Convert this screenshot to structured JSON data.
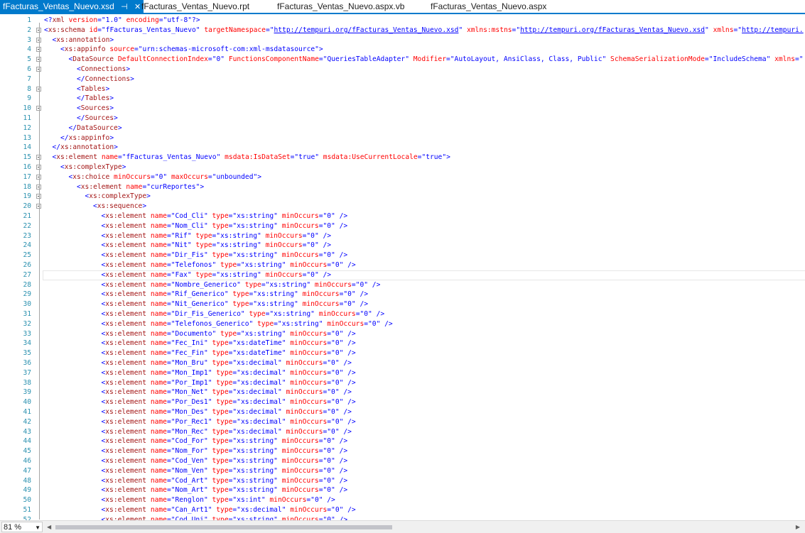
{
  "tabs": [
    {
      "label": "fFacturas_Ventas_Nuevo.xsd",
      "active": true
    },
    {
      "label": "fFacturas_Ventas_Nuevo.rpt",
      "active": false
    },
    {
      "label": "fFacturas_Ventas_Nuevo.aspx.vb",
      "active": false
    },
    {
      "label": "fFacturas_Ventas_Nuevo.aspx",
      "active": false
    }
  ],
  "icons": {
    "pin": "pin-icon",
    "close": "close-icon",
    "zoom_dropdown": "chevron-down-icon",
    "scroll_left": "arrow-left-icon",
    "scroll_right": "arrow-right-icon"
  },
  "colors": {
    "accent": "#007acc",
    "tag": "#a31515",
    "attr": "#ff0000",
    "value": "#0000ff",
    "linenum": "#2b91af"
  },
  "status": {
    "zoom": "81 %"
  },
  "lines": [
    {
      "n": "1",
      "fold": false,
      "html": "<span class='d'>&lt;?</span><span class='t'>xml</span> <span class='a'>version</span><span class='d'>=</span><span class='d'>\"</span><span class='v'>1.0</span><span class='d'>\"</span> <span class='a'>encoding</span><span class='d'>=</span><span class='d'>\"</span><span class='v'>utf-8</span><span class='d'>\"?&gt;</span>"
    },
    {
      "n": "2",
      "fold": true,
      "html": "<span class='d'>&lt;</span><span class='t'>xs:schema</span> <span class='a'>id</span><span class='d'>=</span><span class='d'>\"</span><span class='v'>fFacturas_Ventas_Nuevo</span><span class='d'>\"</span> <span class='a'>targetNamespace</span><span class='d'>=</span><span class='d'>\"</span><span class='u'>http://tempuri.org/fFacturas_Ventas_Nuevo.xsd</span><span class='d'>\"</span> <span class='a'>xmlns:mstns</span><span class='d'>=</span><span class='d'>\"</span><span class='u'>http://tempuri.org/fFacturas_Ventas_Nuevo.xsd</span><span class='d'>\"</span> <span class='a'>xmlns</span><span class='d'>=</span><span class='d'>\"</span><span class='u'>http://tempuri.</span>"
    },
    {
      "n": "3",
      "fold": true,
      "indent": 1,
      "html": "<span class='d'>&lt;</span><span class='t'>xs:annotation</span><span class='d'>&gt;</span>"
    },
    {
      "n": "4",
      "fold": true,
      "indent": 2,
      "html": "<span class='d'>&lt;</span><span class='t'>xs:appinfo</span> <span class='a'>source</span><span class='d'>=</span><span class='d'>\"</span><span class='v'>urn:schemas-microsoft-com:xml-msdatasource</span><span class='d'>\"&gt;</span>"
    },
    {
      "n": "5",
      "fold": true,
      "indent": 3,
      "html": "<span class='d'>&lt;</span><span class='t'>DataSource</span> <span class='a'>DefaultConnectionIndex</span><span class='d'>=</span><span class='d'>\"</span><span class='v'>0</span><span class='d'>\"</span> <span class='a'>FunctionsComponentName</span><span class='d'>=</span><span class='d'>\"</span><span class='v'>QueriesTableAdapter</span><span class='d'>\"</span> <span class='a'>Modifier</span><span class='d'>=</span><span class='d'>\"</span><span class='v'>AutoLayout, AnsiClass, Class, Public</span><span class='d'>\"</span> <span class='a'>SchemaSerializationMode</span><span class='d'>=</span><span class='d'>\"</span><span class='v'>IncludeSchema</span><span class='d'>\"</span> <span class='a'>xmlns</span><span class='d'>=</span><span class='d'>\"</span>"
    },
    {
      "n": "6",
      "fold": true,
      "indent": 4,
      "html": "<span class='d'>&lt;</span><span class='t'>Connections</span><span class='d'>&gt;</span>"
    },
    {
      "n": "7",
      "fold": false,
      "indent": 4,
      "html": "<span class='d'>&lt;/</span><span class='t'>Connections</span><span class='d'>&gt;</span>"
    },
    {
      "n": "8",
      "fold": true,
      "indent": 4,
      "html": "<span class='d'>&lt;</span><span class='t'>Tables</span><span class='d'>&gt;</span>"
    },
    {
      "n": "9",
      "fold": false,
      "indent": 4,
      "html": "<span class='d'>&lt;/</span><span class='t'>Tables</span><span class='d'>&gt;</span>"
    },
    {
      "n": "10",
      "fold": true,
      "indent": 4,
      "html": "<span class='d'>&lt;</span><span class='t'>Sources</span><span class='d'>&gt;</span>"
    },
    {
      "n": "11",
      "fold": false,
      "indent": 4,
      "html": "<span class='d'>&lt;/</span><span class='t'>Sources</span><span class='d'>&gt;</span>"
    },
    {
      "n": "12",
      "fold": false,
      "indent": 3,
      "html": "<span class='d'>&lt;/</span><span class='t'>DataSource</span><span class='d'>&gt;</span>"
    },
    {
      "n": "13",
      "fold": false,
      "indent": 2,
      "html": "<span class='d'>&lt;/</span><span class='t'>xs:appinfo</span><span class='d'>&gt;</span>"
    },
    {
      "n": "14",
      "fold": false,
      "indent": 1,
      "html": "<span class='d'>&lt;/</span><span class='t'>xs:annotation</span><span class='d'>&gt;</span>"
    },
    {
      "n": "15",
      "fold": true,
      "indent": 1,
      "html": "<span class='d'>&lt;</span><span class='t'>xs:element</span> <span class='a'>name</span><span class='d'>=</span><span class='d'>\"</span><span class='v'>fFacturas_Ventas_Nuevo</span><span class='d'>\"</span> <span class='a'>msdata:IsDataSet</span><span class='d'>=</span><span class='d'>\"</span><span class='v'>true</span><span class='d'>\"</span> <span class='a'>msdata:UseCurrentLocale</span><span class='d'>=</span><span class='d'>\"</span><span class='v'>true</span><span class='d'>\"&gt;</span>"
    },
    {
      "n": "16",
      "fold": true,
      "indent": 2,
      "html": "<span class='d'>&lt;</span><span class='t'>xs:complexType</span><span class='d'>&gt;</span>"
    },
    {
      "n": "17",
      "fold": true,
      "indent": 3,
      "html": "<span class='d'>&lt;</span><span class='t'>xs:choice</span> <span class='a'>minOccurs</span><span class='d'>=</span><span class='d'>\"</span><span class='v'>0</span><span class='d'>\"</span> <span class='a'>maxOccurs</span><span class='d'>=</span><span class='d'>\"</span><span class='v'>unbounded</span><span class='d'>\"&gt;</span>"
    },
    {
      "n": "18",
      "fold": true,
      "indent": 4,
      "html": "<span class='d'>&lt;</span><span class='t'>xs:element</span> <span class='a'>name</span><span class='d'>=</span><span class='d'>\"</span><span class='v'>curReportes</span><span class='d'>\"&gt;</span>"
    },
    {
      "n": "19",
      "fold": true,
      "indent": 5,
      "html": "<span class='d'>&lt;</span><span class='t'>xs:complexType</span><span class='d'>&gt;</span>"
    },
    {
      "n": "20",
      "fold": true,
      "indent": 6,
      "html": "<span class='d'>&lt;</span><span class='t'>xs:sequence</span><span class='d'>&gt;</span>"
    }
  ],
  "elements": [
    {
      "n": "21",
      "name": "Cod_Cli",
      "type": "xs:string"
    },
    {
      "n": "22",
      "name": "Nom_Cli",
      "type": "xs:string"
    },
    {
      "n": "23",
      "name": "Rif",
      "type": "xs:string"
    },
    {
      "n": "24",
      "name": "Nit",
      "type": "xs:string"
    },
    {
      "n": "25",
      "name": "Dir_Fis",
      "type": "xs:string"
    },
    {
      "n": "26",
      "name": "Telefonos",
      "type": "xs:string"
    },
    {
      "n": "27",
      "name": "Fax",
      "type": "xs:string"
    },
    {
      "n": "28",
      "name": "Nombre_Generico",
      "type": "xs:string"
    },
    {
      "n": "29",
      "name": "Rif_Generico",
      "type": "xs:string"
    },
    {
      "n": "30",
      "name": "Nit_Generico",
      "type": "xs:string"
    },
    {
      "n": "31",
      "name": "Dir_Fis_Generico",
      "type": "xs:string"
    },
    {
      "n": "32",
      "name": "Telefonos_Generico",
      "type": "xs:string"
    },
    {
      "n": "33",
      "name": "Documento",
      "type": "xs:string"
    },
    {
      "n": "34",
      "name": "Fec_Ini",
      "type": "xs:dateTime"
    },
    {
      "n": "35",
      "name": "Fec_Fin",
      "type": "xs:dateTime"
    },
    {
      "n": "36",
      "name": "Mon_Bru",
      "type": "xs:decimal"
    },
    {
      "n": "37",
      "name": "Mon_Imp1",
      "type": "xs:decimal"
    },
    {
      "n": "38",
      "name": "Por_Imp1",
      "type": "xs:decimal"
    },
    {
      "n": "39",
      "name": "Mon_Net",
      "type": "xs:decimal"
    },
    {
      "n": "40",
      "name": "Por_Des1",
      "type": "xs:decimal"
    },
    {
      "n": "41",
      "name": "Mon_Des",
      "type": "xs:decimal"
    },
    {
      "n": "42",
      "name": "Por_Rec1",
      "type": "xs:decimal"
    },
    {
      "n": "43",
      "name": "Mon_Rec",
      "type": "xs:decimal"
    },
    {
      "n": "44",
      "name": "Cod_For",
      "type": "xs:string"
    },
    {
      "n": "45",
      "name": "Nom_For",
      "type": "xs:string"
    },
    {
      "n": "46",
      "name": "Cod_Ven",
      "type": "xs:string"
    },
    {
      "n": "47",
      "name": "Nom_Ven",
      "type": "xs:string"
    },
    {
      "n": "48",
      "name": "Cod_Art",
      "type": "xs:string"
    },
    {
      "n": "49",
      "name": "Nom_Art",
      "type": "xs:string"
    },
    {
      "n": "50",
      "name": "Renglon",
      "type": "xs:int"
    },
    {
      "n": "51",
      "name": "Can_Art1",
      "type": "xs:decimal"
    },
    {
      "n": "52",
      "name": "Cod_Uni",
      "type": "xs:string"
    }
  ],
  "attr_labels": {
    "name": "name",
    "type": "type",
    "minOccurs": "minOccurs",
    "minOccurs_value": "0",
    "tag": "xs:element"
  }
}
